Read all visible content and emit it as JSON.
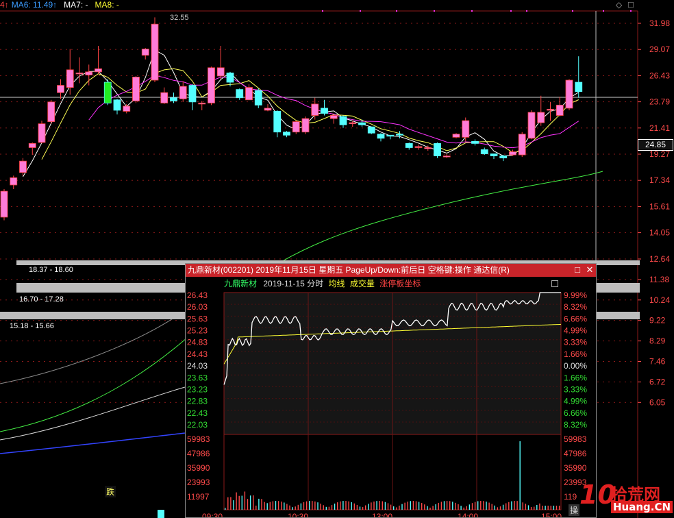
{
  "legend": {
    "prefix": "4↑",
    "ma6": "MA6: 11.49↑",
    "ma7": "MA7: -",
    "ma8": "MA8: -",
    "diamond": "◇",
    "box": "□",
    "colors": {
      "ma6": "#3b9cff",
      "ma7": "#ffffff",
      "ma8": "#ffff33",
      "prefix": "#ff4444"
    }
  },
  "price_axis": {
    "labels": [
      "31.98",
      "29.07",
      "26.43",
      "23.79",
      "21.41",
      "19.27",
      "17.34",
      "15.61",
      "14.05",
      "12.64",
      "11.38",
      "10.24",
      "9.22",
      "8.29",
      "7.46",
      "6.72",
      "6.05"
    ],
    "current": "24.85"
  },
  "annotations": {
    "high": "32.55",
    "band1": "18.37 - 18.60",
    "band2": "16.70 - 17.28",
    "band3": "15.18 - 15.66",
    "fall_marker": "跌"
  },
  "candles": [
    {
      "o": 13.3,
      "c": 15.8,
      "h": 16.0,
      "l": 13.0
    },
    {
      "o": 16.4,
      "c": 17.1,
      "h": 17.3,
      "l": 16.0
    },
    {
      "o": 17.6,
      "c": 18.7,
      "h": 19.0,
      "l": 17.3
    },
    {
      "o": 20.0,
      "c": 20.4,
      "h": 20.5,
      "l": 19.3
    },
    {
      "o": 20.5,
      "c": 22.3,
      "h": 22.6,
      "l": 20.4
    },
    {
      "o": 22.5,
      "c": 24.4,
      "h": 24.6,
      "l": 22.3
    },
    {
      "o": 25.3,
      "c": 26.0,
      "h": 26.6,
      "l": 24.7
    },
    {
      "o": 25.8,
      "c": 27.5,
      "h": 29.5,
      "l": 25.1
    },
    {
      "o": 27.1,
      "c": 27.2,
      "h": 28.7,
      "l": 26.2
    },
    {
      "o": 27.0,
      "c": 27.3,
      "h": 28.0,
      "l": 26.0
    },
    {
      "o": 27.3,
      "c": 27.6,
      "h": 29.8,
      "l": 27.1
    },
    {
      "o": 26.3,
      "c": 24.3,
      "h": 26.6,
      "l": 24.1
    },
    {
      "o": 24.6,
      "c": 23.6,
      "h": 24.7,
      "l": 23.2
    },
    {
      "o": 23.5,
      "c": 24.0,
      "h": 24.2,
      "l": 23.3
    },
    {
      "o": 24.5,
      "c": 26.8,
      "h": 26.9,
      "l": 24.3
    },
    {
      "o": 28.9,
      "c": 29.5,
      "h": 29.6,
      "l": 28.5
    },
    {
      "o": 26.5,
      "c": 31.9,
      "h": 32.55,
      "l": 26.3
    },
    {
      "o": 24.3,
      "c": 25.3,
      "h": 25.8,
      "l": 24.2
    },
    {
      "o": 24.8,
      "c": 24.5,
      "h": 25.3,
      "l": 24.3
    },
    {
      "o": 24.7,
      "c": 25.9,
      "h": 26.4,
      "l": 24.4
    },
    {
      "o": 26.0,
      "c": 24.4,
      "h": 26.1,
      "l": 23.6
    },
    {
      "o": 24.2,
      "c": 24.3,
      "h": 24.5,
      "l": 23.6
    },
    {
      "o": 24.3,
      "c": 27.7,
      "h": 27.8,
      "l": 24.1
    },
    {
      "o": 26.9,
      "c": 27.7,
      "h": 29.8,
      "l": 26.6
    },
    {
      "o": 27.2,
      "c": 26.3,
      "h": 27.3,
      "l": 25.9
    },
    {
      "o": 25.6,
      "c": 24.8,
      "h": 25.7,
      "l": 24.6
    },
    {
      "o": 24.6,
      "c": 25.8,
      "h": 26.1,
      "l": 24.6
    },
    {
      "o": 25.5,
      "c": 24.1,
      "h": 25.7,
      "l": 23.8
    },
    {
      "o": 23.6,
      "c": 23.8,
      "h": 24.2,
      "l": 23.5
    },
    {
      "o": 23.5,
      "c": 21.5,
      "h": 23.6,
      "l": 21.0
    },
    {
      "o": 21.5,
      "c": 21.2,
      "h": 21.6,
      "l": 21.0
    },
    {
      "o": 21.5,
      "c": 22.5,
      "h": 22.6,
      "l": 21.3
    },
    {
      "o": 21.5,
      "c": 22.8,
      "h": 23.0,
      "l": 21.3
    },
    {
      "o": 23.1,
      "c": 24.2,
      "h": 24.8,
      "l": 22.7
    },
    {
      "o": 23.8,
      "c": 23.3,
      "h": 24.6,
      "l": 23.1
    },
    {
      "o": 22.8,
      "c": 23.1,
      "h": 23.2,
      "l": 22.3
    },
    {
      "o": 23.0,
      "c": 22.2,
      "h": 23.1,
      "l": 21.9
    },
    {
      "o": 22.3,
      "c": 22.4,
      "h": 22.6,
      "l": 22.0
    },
    {
      "o": 22.4,
      "c": 22.2,
      "h": 22.7,
      "l": 22.0
    },
    {
      "o": 22.0,
      "c": 21.4,
      "h": 22.0,
      "l": 21.3
    },
    {
      "o": 21.3,
      "c": 20.9,
      "h": 21.4,
      "l": 20.6
    },
    {
      "o": 21.2,
      "c": 21.1,
      "h": 21.2,
      "l": 20.8
    },
    {
      "o": 21.3,
      "c": 21.2,
      "h": 21.6,
      "l": 20.9
    },
    {
      "o": 20.4,
      "c": 20.0,
      "h": 20.5,
      "l": 19.8
    },
    {
      "o": 20.0,
      "c": 20.1,
      "h": 20.3,
      "l": 19.8
    },
    {
      "o": 19.9,
      "c": 20.0,
      "h": 20.2,
      "l": 19.7
    },
    {
      "o": 20.4,
      "c": 19.2,
      "h": 20.5,
      "l": 19.0
    },
    {
      "o": 19.2,
      "c": 19.2,
      "h": 19.4,
      "l": 19.0
    },
    {
      "o": 21.0,
      "c": 21.3,
      "h": 21.4,
      "l": 20.9
    },
    {
      "o": 21.0,
      "c": 22.6,
      "h": 22.9,
      "l": 20.6
    },
    {
      "o": 20.6,
      "c": 20.4,
      "h": 20.8,
      "l": 20.2
    },
    {
      "o": 19.8,
      "c": 19.4,
      "h": 20.0,
      "l": 19.3
    },
    {
      "o": 19.4,
      "c": 19.2,
      "h": 19.4,
      "l": 18.9
    },
    {
      "o": 19.2,
      "c": 19.0,
      "h": 19.3,
      "l": 18.7
    },
    {
      "o": 19.3,
      "c": 19.6,
      "h": 19.8,
      "l": 19.2
    },
    {
      "o": 19.3,
      "c": 21.3,
      "h": 21.5,
      "l": 19.1
    },
    {
      "o": 20.9,
      "c": 23.4,
      "h": 23.6,
      "l": 20.8
    },
    {
      "o": 22.4,
      "c": 23.4,
      "h": 25.0,
      "l": 22.1
    },
    {
      "o": 23.7,
      "c": 23.7,
      "h": 24.4,
      "l": 22.6
    },
    {
      "o": 23.1,
      "c": 24.1,
      "h": 24.9,
      "l": 23.0
    },
    {
      "o": 23.8,
      "c": 26.5,
      "h": 26.6,
      "l": 23.6
    },
    {
      "o": 26.3,
      "c": 25.4,
      "h": 28.8,
      "l": 24.8
    }
  ],
  "popup": {
    "title": "九鼎新材(002201) 2019年11月15日 星期五 PageUp/Down:前后日 空格键:操作 通达信(R)",
    "maximize_icon": "□",
    "close_icon": "✕",
    "header": {
      "name": "九鼎新材",
      "date": "2019-11-15 分时",
      "avg": "均线",
      "vol": "成交量",
      "limit": "涨停板坐标"
    },
    "price_labels": [
      "26.43",
      "26.03",
      "25.63",
      "25.23",
      "24.83",
      "24.43",
      "24.03",
      "23.63",
      "23.23",
      "22.83",
      "22.43",
      "22.03"
    ],
    "pct_labels": [
      "9.99%",
      "8.32%",
      "6.66%",
      "4.99%",
      "3.33%",
      "1.66%",
      "0.00%",
      "1.66%",
      "3.33%",
      "4.99%",
      "6.66%",
      "8.32%"
    ],
    "vol_labels": [
      "59983",
      "47986",
      "35990",
      "23993",
      "11997"
    ],
    "vol_labels_right": [
      "59983",
      "47986",
      "35990",
      "23993",
      "119"
    ],
    "time_labels": [
      "09:30",
      "10:30",
      "13:00",
      "14:00",
      "15:00"
    ],
    "tab_hint": "操"
  },
  "watermark": {
    "logo": "10",
    "text": "拾荒网",
    "url": "Huang.CN"
  }
}
